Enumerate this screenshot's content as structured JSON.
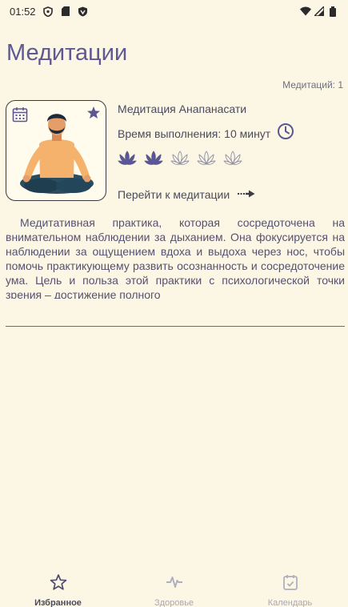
{
  "status_bar": {
    "time": "01:52"
  },
  "page": {
    "title": "Медитации",
    "count_label": "Медитаций: 1"
  },
  "card": {
    "title": "Медитация Анапанасати",
    "duration": "Время выполнения: 10 минут",
    "difficulty": {
      "filled": 2,
      "total": 5
    },
    "link_label": "Перейти к медитации",
    "description": "Медитативная практика, которая сосредоточена на внимательном наблюдении за дыханием. Она фокусируется на наблюдении за ощущением вдоха и выдоха через нос, чтобы помочь практикующему развить осознанность и сосредоточение ума. Цель и польза этой практики с психологической точки зрения – достижение полного"
  },
  "nav": {
    "items": [
      {
        "label": "Избранное",
        "icon": "star-icon",
        "active": true
      },
      {
        "label": "Здоровье",
        "icon": "pulse-icon",
        "active": false
      },
      {
        "label": "Календарь",
        "icon": "calendar-check-icon",
        "active": false
      }
    ]
  },
  "colors": {
    "accent": "#5f5893",
    "background": "#fcf7e4",
    "lotus": "#5b5793"
  }
}
